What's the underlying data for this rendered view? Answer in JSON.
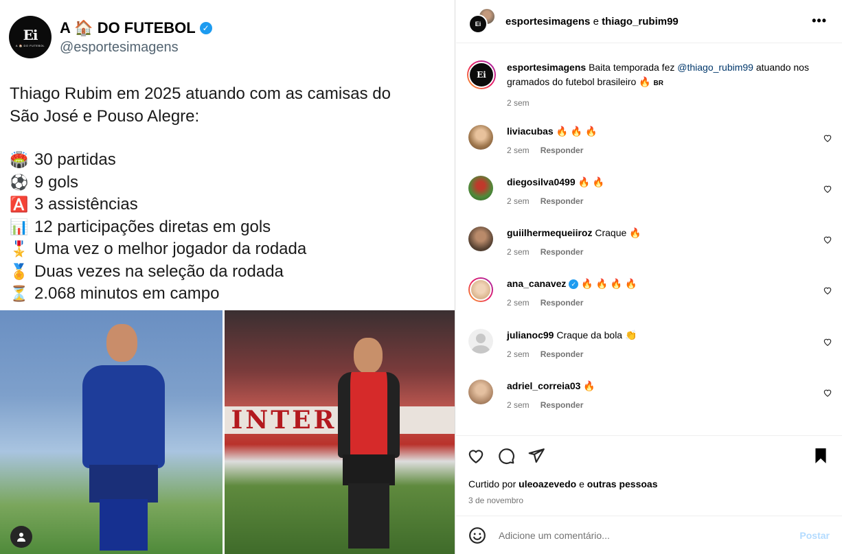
{
  "tweet": {
    "avatar_text": "Ei",
    "avatar_subtext": "A 🏠 DO FUTEBOL",
    "name": "A 🏠 DO FUTEBOL",
    "handle": "@esportesimagens",
    "text_lines": [
      "Thiago Rubim em 2025 atuando com as camisas do",
      "São José e Pouso Alegre:"
    ],
    "stats": [
      {
        "emoji": "🏟️",
        "text": "30 partidas"
      },
      {
        "emoji": "⚽",
        "text": "9 gols"
      },
      {
        "emoji": "🅰️",
        "text": "3 assistências"
      },
      {
        "emoji": "📊",
        "text": "12 participações diretas em gols"
      },
      {
        "emoji": "🎖️",
        "text": "Uma vez o melhor jogador da rodada"
      },
      {
        "emoji": "🏅",
        "text": "Duas vezes na seleção da rodada"
      },
      {
        "emoji": "⏳",
        "text": "2.068 minutos em campo"
      }
    ],
    "photo_right_banner": "INTER"
  },
  "header": {
    "user1": "esportesimagens",
    "connector": "e",
    "user2": "thiago_rubim99",
    "more_label": "•••"
  },
  "caption": {
    "username": "esportesimagens",
    "text_before": "Baita temporada fez",
    "mention": "@thiago_rubim99",
    "text_after": "atuando nos gramados do futebol brasileiro 🔥",
    "flag": "BR",
    "time": "2 sem"
  },
  "comments": [
    {
      "username": "liviacubas",
      "text": "🔥 🔥 🔥",
      "time": "2 sem",
      "reply": "Responder",
      "verified": false
    },
    {
      "username": "diegosilva0499",
      "text": "🔥 🔥",
      "time": "2 sem",
      "reply": "Responder",
      "verified": false
    },
    {
      "username": "guiilhermequeiiroz",
      "text": "Craque 🔥",
      "time": "2 sem",
      "reply": "Responder",
      "verified": false
    },
    {
      "username": "ana_canavez",
      "text": "🔥 🔥 🔥 🔥",
      "time": "2 sem",
      "reply": "Responder",
      "verified": true
    },
    {
      "username": "julianoc99",
      "text": "Craque da bola 👏",
      "time": "2 sem",
      "reply": "Responder",
      "verified": false
    },
    {
      "username": "adriel_correia03",
      "text": "🔥",
      "time": "2 sem",
      "reply": "Responder",
      "verified": false
    }
  ],
  "likes": {
    "prefix": "Curtido por",
    "user": "uleoazevedo",
    "connector": "e",
    "others": "outras pessoas"
  },
  "date": "3 de novembro",
  "add_comment": {
    "placeholder": "Adicione um comentário...",
    "post_label": "Postar"
  },
  "colors": {
    "mention": "#00376b",
    "verified": "#1d9bf0",
    "muted": "#737373",
    "post_button_disabled": "#b3dbff"
  }
}
